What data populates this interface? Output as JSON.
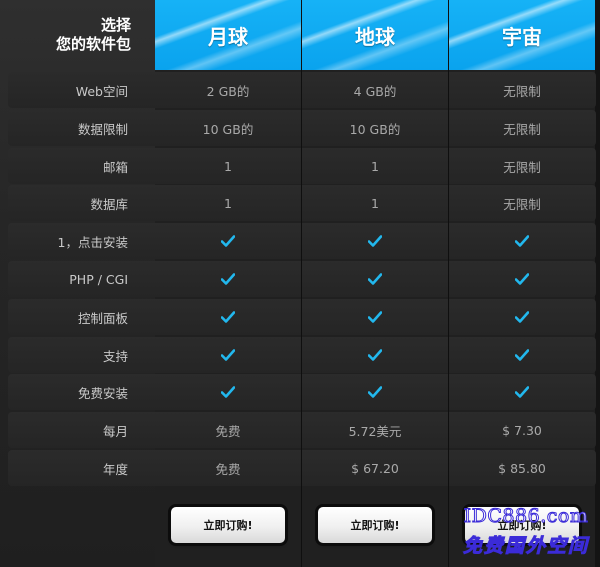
{
  "header": {
    "select_line1": "选择",
    "select_line2": "您的软件包"
  },
  "plans": [
    {
      "name": "月球"
    },
    {
      "name": "地球"
    },
    {
      "name": "宇宙"
    }
  ],
  "rows": [
    {
      "label": "Web空间",
      "values": [
        "2 GB的",
        "4 GB的",
        "无限制"
      ]
    },
    {
      "label": "数据限制",
      "values": [
        "10 GB的",
        "10 GB的",
        "无限制"
      ]
    },
    {
      "label": "邮箱",
      "values": [
        "1",
        "1",
        "无限制"
      ]
    },
    {
      "label": "数据库",
      "values": [
        "1",
        "1",
        "无限制"
      ]
    },
    {
      "label": "1，点击安装",
      "values": [
        "check",
        "check",
        "check"
      ]
    },
    {
      "label": "PHP / CGI",
      "values": [
        "check",
        "check",
        "check"
      ]
    },
    {
      "label": "控制面板",
      "values": [
        "check",
        "check",
        "check"
      ]
    },
    {
      "label": "支持",
      "values": [
        "check",
        "check",
        "check"
      ]
    },
    {
      "label": "免费安装",
      "values": [
        "check",
        "check",
        "check"
      ]
    },
    {
      "label": "每月",
      "values": [
        "免费",
        "5.72美元",
        "$ 7.30"
      ]
    },
    {
      "label": "年度",
      "values": [
        "免费",
        "$ 67.20",
        "$ 85.80"
      ]
    }
  ],
  "order_button_label": "立即订购!",
  "watermark": {
    "line1": "IDC886.com",
    "line2": "免费国外空间"
  },
  "colors": {
    "header_blue": "#0aa3ee",
    "check": "#22b8ee",
    "text": "#a9a9a9",
    "label": "#c9c9c9"
  },
  "icons": {
    "check": "check-icon"
  }
}
